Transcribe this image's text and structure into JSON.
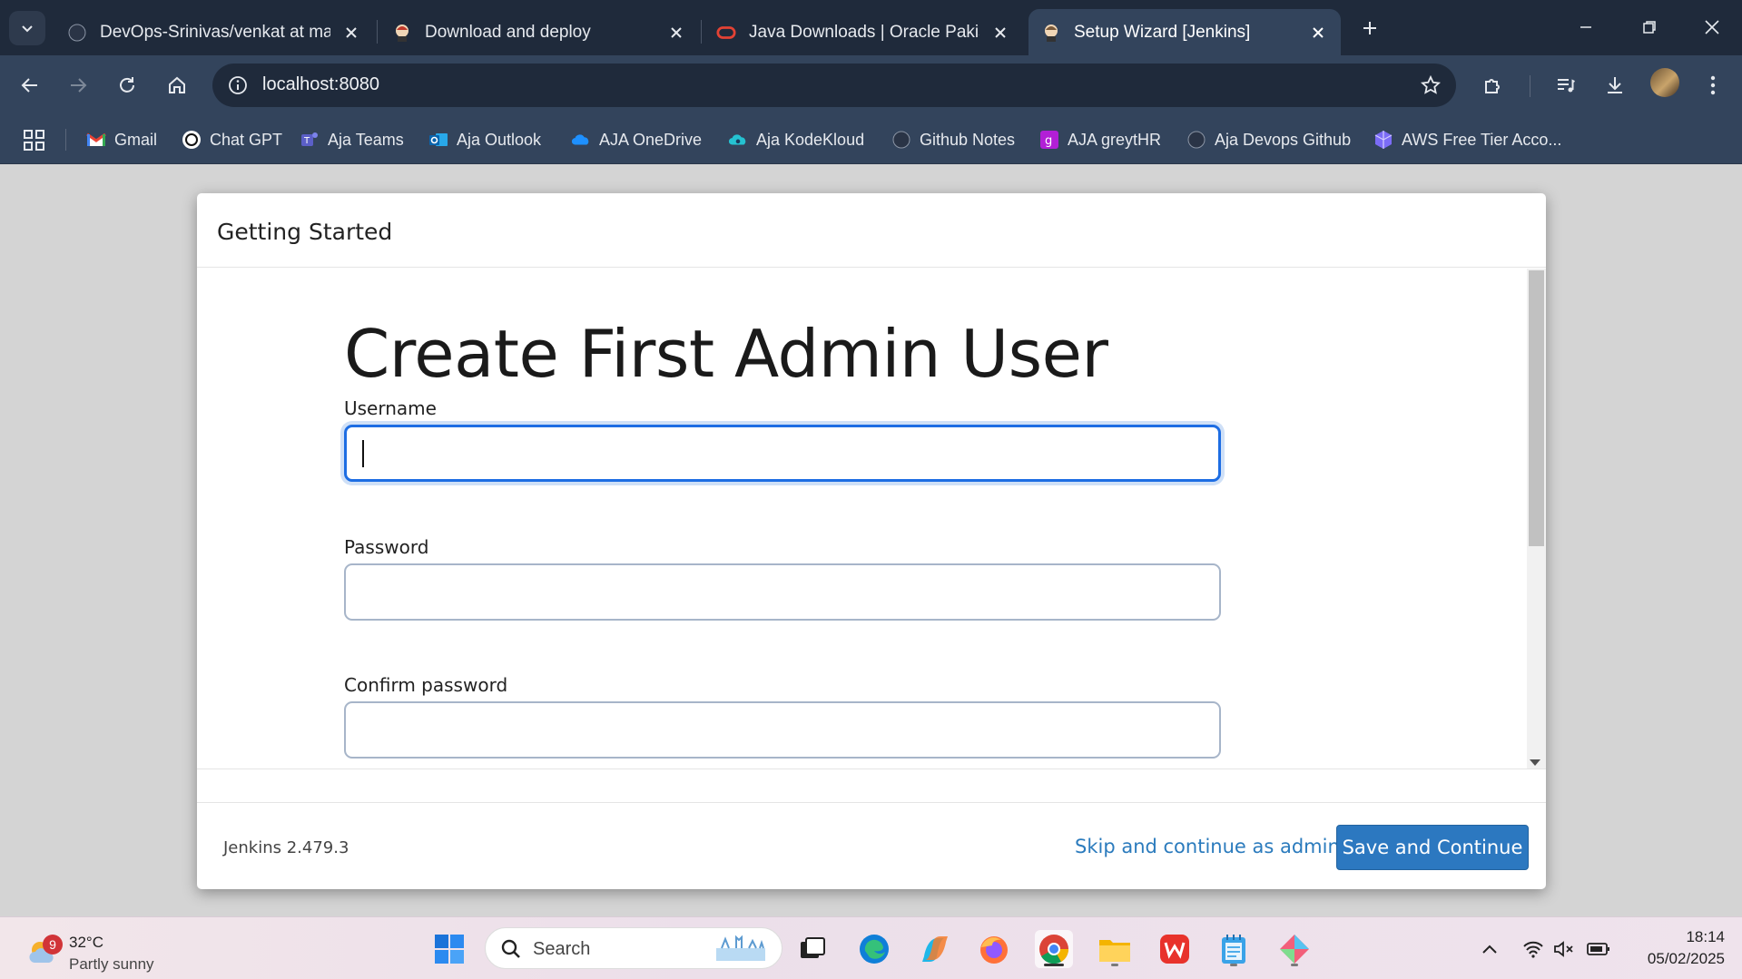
{
  "browser": {
    "tabs": [
      {
        "title": "DevOps-Srinivas/venkat at main",
        "active": false
      },
      {
        "title": "Download and deploy",
        "active": false
      },
      {
        "title": "Java Downloads | Oracle Pakistan",
        "active": false
      },
      {
        "title": "Setup Wizard [Jenkins]",
        "active": true
      }
    ],
    "url": "localhost:8080",
    "bookmarks": [
      {
        "label": "Gmail",
        "icon": "gmail-icon"
      },
      {
        "label": "Chat GPT",
        "icon": "chatgpt-icon"
      },
      {
        "label": "Aja Teams",
        "icon": "teams-icon"
      },
      {
        "label": "Aja Outlook",
        "icon": "outlook-icon"
      },
      {
        "label": "AJA OneDrive",
        "icon": "onedrive-icon"
      },
      {
        "label": "Aja KodeKloud",
        "icon": "kodekloud-icon"
      },
      {
        "label": "Github Notes",
        "icon": "github-icon"
      },
      {
        "label": "AJA greytHR",
        "icon": "greythr-icon"
      },
      {
        "label": "Aja Devops Github",
        "icon": "github-icon"
      },
      {
        "label": "AWS Free Tier Acco...",
        "icon": "aws-icon"
      }
    ]
  },
  "dialog": {
    "header": "Getting Started",
    "title": "Create First Admin User",
    "fields": [
      {
        "label": "Username",
        "value": ""
      },
      {
        "label": "Password",
        "value": ""
      },
      {
        "label": "Confirm password",
        "value": ""
      }
    ],
    "version": "Jenkins 2.479.3",
    "skip_label": "Skip and continue as admin",
    "save_label": "Save and Continue"
  },
  "taskbar": {
    "weather": {
      "badge": "9",
      "temp": "32°C",
      "condition": "Partly sunny"
    },
    "search_placeholder": "Search",
    "time": "18:14",
    "date": "05/02/2025"
  },
  "colors": {
    "accent": "#2c78c0",
    "focus": "#1d6de3",
    "chrome_dark": "#1f2a3b",
    "chrome_toolbar": "#33445c"
  }
}
